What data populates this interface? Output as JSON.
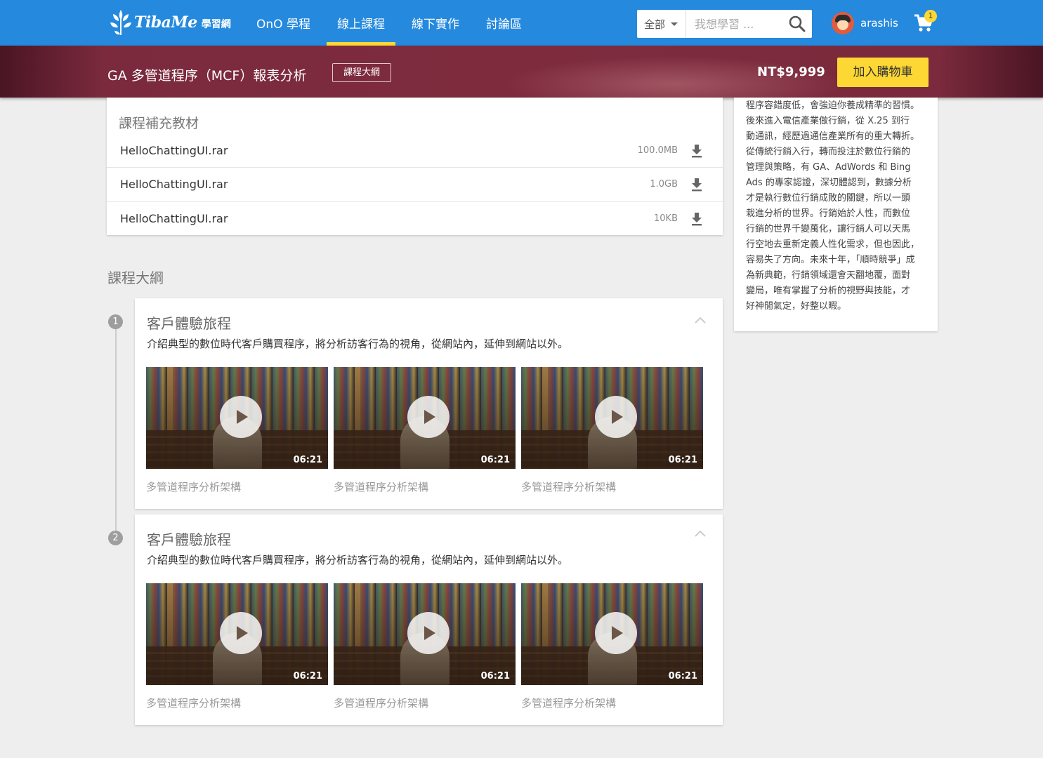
{
  "header": {
    "logo_text": "TibaMe",
    "logo_sub": "學習網",
    "nav": [
      {
        "label": "OnO 學程"
      },
      {
        "label": "線上課程"
      },
      {
        "label": "線下實作"
      },
      {
        "label": "討論區"
      }
    ],
    "active_nav": "線上課程",
    "search": {
      "category": "全部",
      "placeholder": "我想學習 ..."
    },
    "user": {
      "name": "arashis"
    },
    "cart_count": "1",
    "accent_color": "#fdd835",
    "brand_color": "#2589de"
  },
  "course": {
    "title": "GA 多管道程序（MCF）報表分析",
    "outline_button": "課程大綱",
    "price": "NT$9,999",
    "add_to_cart": "加入購物車"
  },
  "materials": {
    "title": "課程補充教材",
    "files": [
      {
        "name": "HelloChattingUI.rar",
        "size": "100.0MB"
      },
      {
        "name": "HelloChattingUI.rar",
        "size": "1.0GB"
      },
      {
        "name": "HelloChattingUI.rar",
        "size": "10KB"
      }
    ]
  },
  "syllabus": {
    "heading": "課程大綱",
    "chapters": [
      {
        "number": "1",
        "title": "客戶體驗旅程",
        "description": "介紹典型的數位時代客戶購買程序，將分析訪客行為的視角，從網站內，延伸到網站以外。",
        "videos": [
          {
            "label": "多管道程序分析架構",
            "duration": "06:21"
          },
          {
            "label": "多管道程序分析架構",
            "duration": "06:21"
          },
          {
            "label": "多管道程序分析架構",
            "duration": "06:21"
          }
        ]
      },
      {
        "number": "2",
        "title": "客戶體驗旅程",
        "description": "介紹典型的數位時代客戶購買程序，將分析訪客行為的視角，從網站內，延伸到網站以外。",
        "videos": [
          {
            "label": "多管道程序分析架構",
            "duration": "06:21"
          },
          {
            "label": "多管道程序分析架構",
            "duration": "06:21"
          },
          {
            "label": "多管道程序分析架構",
            "duration": "06:21"
          }
        ]
      }
    ]
  },
  "instructor_bio": {
    "lines": [
      "程序容錯度低，會強迫你養成精準的習慣。",
      "後來進入電信產業做行銷，從 X.25 到行",
      "動通訊，經歷過通信產業所有的重大轉折。",
      "從傳統行銷入行，轉而投注於數位行銷的",
      "管理與策略，有 GA、AdWords 和 Bing",
      "Ads 的專家認證，深切體認到，數據分析",
      "才是執行數位行銷成敗的關鍵，所以一頭",
      "栽進分析的世界。行銷始於人性，而數位",
      "行銷的世界千變萬化，讓行銷人可以天馬",
      "行空地去重新定義人性化需求，但也因此，",
      "容易失了方向。未來十年，「順時競爭」成",
      "為新典範，行銷領域還會天翻地覆，面對",
      "變局，唯有掌握了分析的視野與技能，才",
      "好神閒氣定，好整以暇。"
    ]
  },
  "icons": {
    "logo": "tibame-leaf-logo-icon",
    "search": "search-icon",
    "cart": "shopping-cart-icon",
    "download": "download-icon",
    "collapse": "chevron-up-icon",
    "play": "play-icon"
  }
}
